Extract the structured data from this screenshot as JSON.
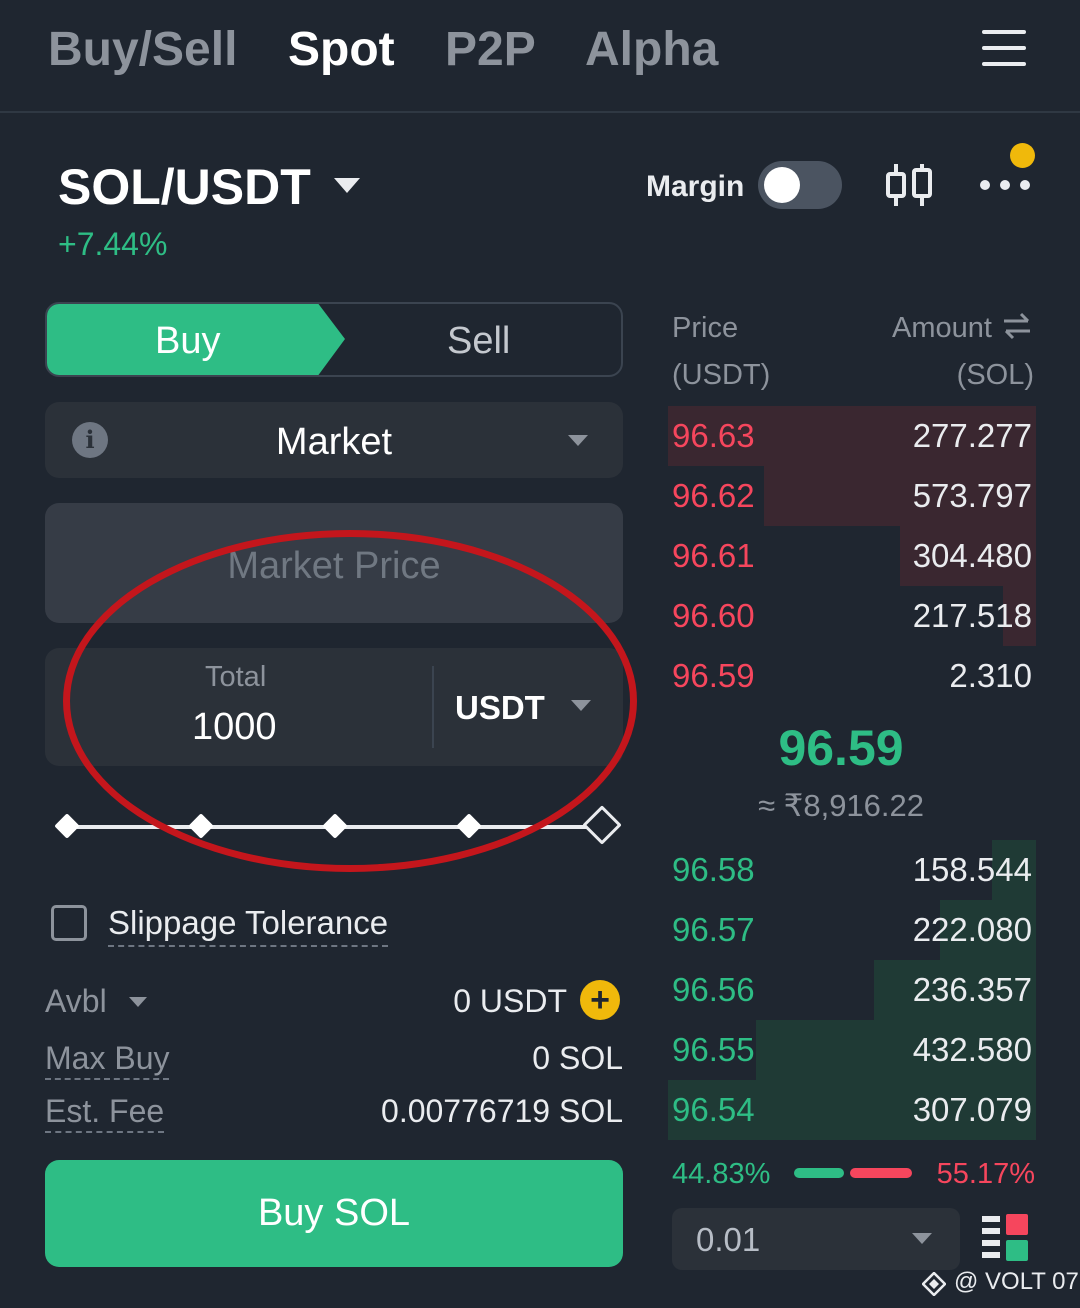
{
  "nav": {
    "tabs": [
      {
        "label": "Buy/Sell",
        "active": false
      },
      {
        "label": "Spot",
        "active": true
      },
      {
        "label": "P2P",
        "active": false
      },
      {
        "label": "Alpha",
        "active": false
      }
    ],
    "menu_icon": "hamburger-menu-icon"
  },
  "header": {
    "pair": "SOL/USDT",
    "change": "+7.44%",
    "margin_label": "Margin",
    "margin_enabled": false,
    "chart_icon": "candlestick-chart-icon",
    "more_icon": "more-dots-icon",
    "has_notification": true
  },
  "order_form": {
    "side_buy": "Buy",
    "side_sell": "Sell",
    "selected_side": "Buy",
    "order_type": "Market",
    "market_price_placeholder": "Market Price",
    "total_label": "Total",
    "total_value": "1000",
    "total_unit": "USDT",
    "slider_fraction": 0,
    "slippage_label": "Slippage Tolerance",
    "slippage_checked": false,
    "avbl_label": "Avbl",
    "avbl_value": "0 USDT",
    "max_buy_label": "Max Buy",
    "max_buy_value": "0 SOL",
    "fee_label": "Est. Fee",
    "fee_value": "0.00776719 SOL",
    "submit_label": "Buy SOL"
  },
  "order_book": {
    "price_header": "Price",
    "price_unit": "(USDT)",
    "amount_header": "Amount",
    "amount_unit": "(SOL)",
    "asks": [
      {
        "price": "96.63",
        "amount": "277.277",
        "depth": 1.0
      },
      {
        "price": "96.62",
        "amount": "573.797",
        "depth": 0.74
      },
      {
        "price": "96.61",
        "amount": "304.480",
        "depth": 0.37
      },
      {
        "price": "96.60",
        "amount": "217.518",
        "depth": 0.09
      },
      {
        "price": "96.59",
        "amount": "2.310",
        "depth": 0.0
      }
    ],
    "last_price": "96.59",
    "fiat_price": "≈ ₹8,916.22",
    "bids": [
      {
        "price": "96.58",
        "amount": "158.544",
        "depth": 0.12
      },
      {
        "price": "96.57",
        "amount": "222.080",
        "depth": 0.26
      },
      {
        "price": "96.56",
        "amount": "236.357",
        "depth": 0.44
      },
      {
        "price": "96.55",
        "amount": "432.580",
        "depth": 0.76
      },
      {
        "price": "96.54",
        "amount": "307.079",
        "depth": 1.0
      }
    ],
    "buy_ratio": "44.83%",
    "sell_ratio": "55.17%",
    "precision": "0.01"
  },
  "watermark": "@ VOLT 07",
  "colors": {
    "background": "#1f2630",
    "panel": "#2b3139",
    "green": "#2ebd85",
    "red": "#f6465d",
    "yellow": "#f0b90b",
    "annotation_red": "#c4161c"
  }
}
